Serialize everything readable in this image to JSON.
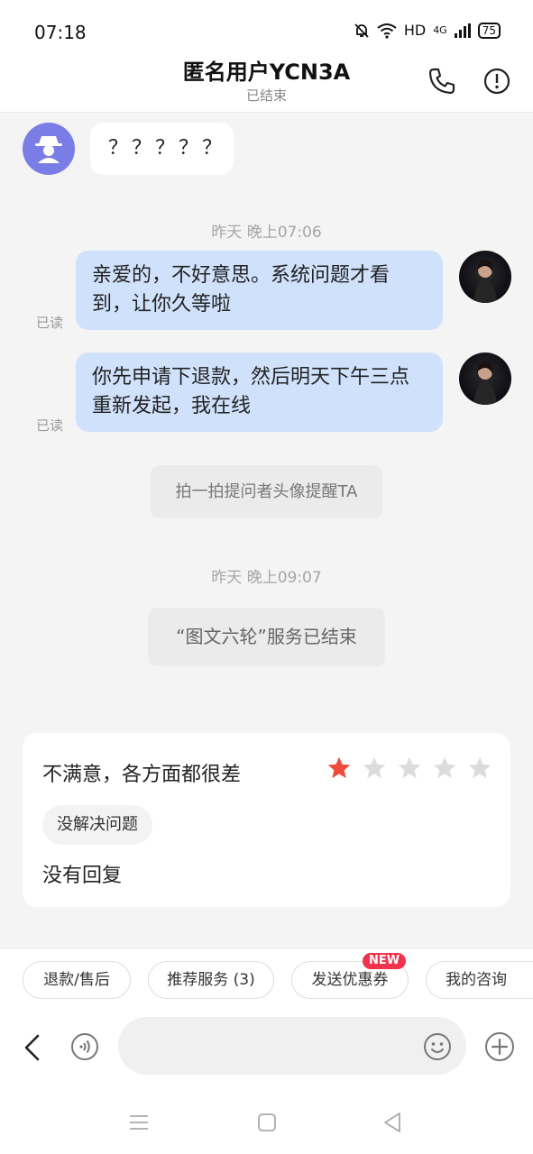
{
  "status_bar": {
    "time": "07:18",
    "network": "HD",
    "signal": "4G",
    "battery": "75"
  },
  "header": {
    "title": "匿名用户YCN3A",
    "subtitle": "已结束"
  },
  "chat": {
    "first_message": "？？？？？",
    "timestamp_1": "昨天 晚上07:06",
    "messages": [
      {
        "text": "亲爱的，不好意思。系统问题才看到，让你久等啦",
        "status": "已读"
      },
      {
        "text": "你先申请下退款，然后明天下午三点重新发起，我在线",
        "status": "已读"
      }
    ],
    "system_nudge": "拍一拍提问者头像提醒TA",
    "timestamp_2": "昨天 晚上09:07",
    "service_ended": "“图文六轮”服务已结束"
  },
  "rating": {
    "title": "不满意，各方面都很差",
    "stars": 1,
    "max_stars": 5,
    "tag": "没解决问题",
    "comment": "没有回复"
  },
  "quick_actions": [
    {
      "label": "退款/售后"
    },
    {
      "label": "推荐服务 (3)"
    },
    {
      "label": "发送优惠券",
      "badge": "NEW"
    },
    {
      "label": "我的咨询"
    }
  ],
  "input": {
    "placeholder": ""
  },
  "colors": {
    "star_active": "#f04a3a",
    "star_inactive": "#dcdcdc",
    "out_bubble": "#cfe1fb",
    "badge": "#f0334d",
    "anon_avatar": "#7b7de6"
  }
}
